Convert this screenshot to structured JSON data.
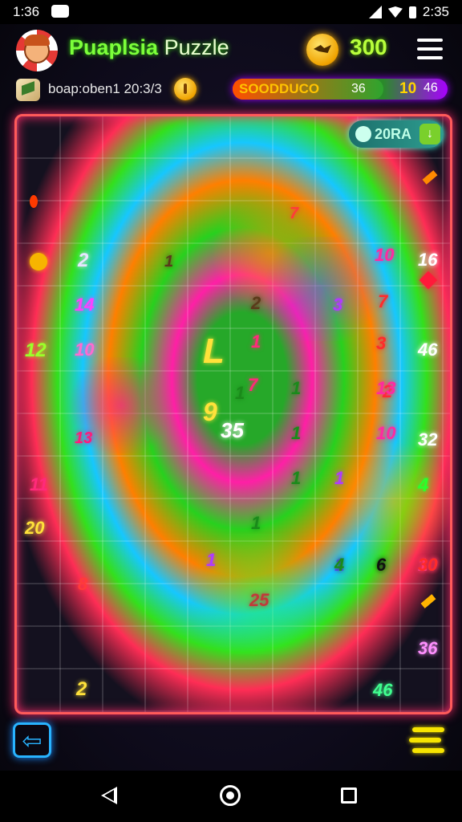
{
  "status_bar": {
    "time": "1:36",
    "right_time": "2:35"
  },
  "header": {
    "title_main": "Puaplsia",
    "title_suffix": "Puzzle",
    "coins": "300"
  },
  "subheader": {
    "level_text": "boap:oben1 20:3/3"
  },
  "progress": {
    "label": "SOODDUCO",
    "mid": "36",
    "count": "10",
    "extra": "46",
    "fill_percent": 70
  },
  "board": {
    "timer": "20RA",
    "numbers": [
      {
        "text": "2",
        "color": "#e6e6ff"
      },
      {
        "text": "14",
        "color": "#ff40ff"
      },
      {
        "text": "12",
        "color": "#9bff2a"
      },
      {
        "text": "10",
        "color": "#ff6ad0"
      },
      {
        "text": "13",
        "color": "#ff1a7a"
      },
      {
        "text": "11",
        "color": "#ff2a7a"
      },
      {
        "text": "20",
        "color": "#ffe23a"
      },
      {
        "text": "2",
        "color": "#ffe23a"
      },
      {
        "text": "8",
        "color": "#ff3a3a"
      },
      {
        "text": "7",
        "color": "#ff3a3a"
      },
      {
        "text": "2",
        "color": "#5a3a1a"
      },
      {
        "text": "1",
        "color": "#5a3a1a"
      },
      {
        "text": "3",
        "color": "#b03aff"
      },
      {
        "text": "1",
        "color": "#1a8a1a"
      },
      {
        "text": "L",
        "color": "#ffe23a"
      },
      {
        "text": "1",
        "color": "#ff2a7a"
      },
      {
        "text": "7",
        "color": "#ff2a7a"
      },
      {
        "text": "9",
        "color": "#ffe23a"
      },
      {
        "text": "35",
        "color": "#ffffff"
      },
      {
        "text": "1",
        "color": "#1a8a1a"
      },
      {
        "text": "1",
        "color": "#1a8a1a"
      },
      {
        "text": "1",
        "color": "#1a8a1a"
      },
      {
        "text": "1",
        "color": "#b03aff"
      },
      {
        "text": "1",
        "color": "#1a8a1a"
      },
      {
        "text": "1",
        "color": "#b03aff"
      },
      {
        "text": "25",
        "color": "#c03a3a"
      },
      {
        "text": "10",
        "color": "#ff2aa0"
      },
      {
        "text": "7",
        "color": "#ff2a2a"
      },
      {
        "text": "3",
        "color": "#ff2a2a"
      },
      {
        "text": "2",
        "color": "#ff2a2a"
      },
      {
        "text": "13",
        "color": "#ff2aa0"
      },
      {
        "text": "10",
        "color": "#ff2aa0"
      },
      {
        "text": "1",
        "color": "#5a3aff"
      },
      {
        "text": "4",
        "color": "#1a8a1a"
      },
      {
        "text": "6",
        "color": "#111111"
      },
      {
        "text": "10",
        "color": "#ff40a0"
      },
      {
        "text": "16",
        "color": "#ffffff"
      },
      {
        "text": "46",
        "color": "#ffffff"
      },
      {
        "text": "32",
        "color": "#ffffff"
      },
      {
        "text": "4",
        "color": "#2aff2a"
      },
      {
        "text": "30",
        "color": "#ff2a2a"
      },
      {
        "text": "36",
        "color": "#ff90ff"
      },
      {
        "text": "46",
        "color": "#40ff90"
      }
    ]
  },
  "icons": {
    "back": "arrow-left-icon",
    "menu": "hamburger-icon",
    "more": "stacked-bars-icon"
  }
}
